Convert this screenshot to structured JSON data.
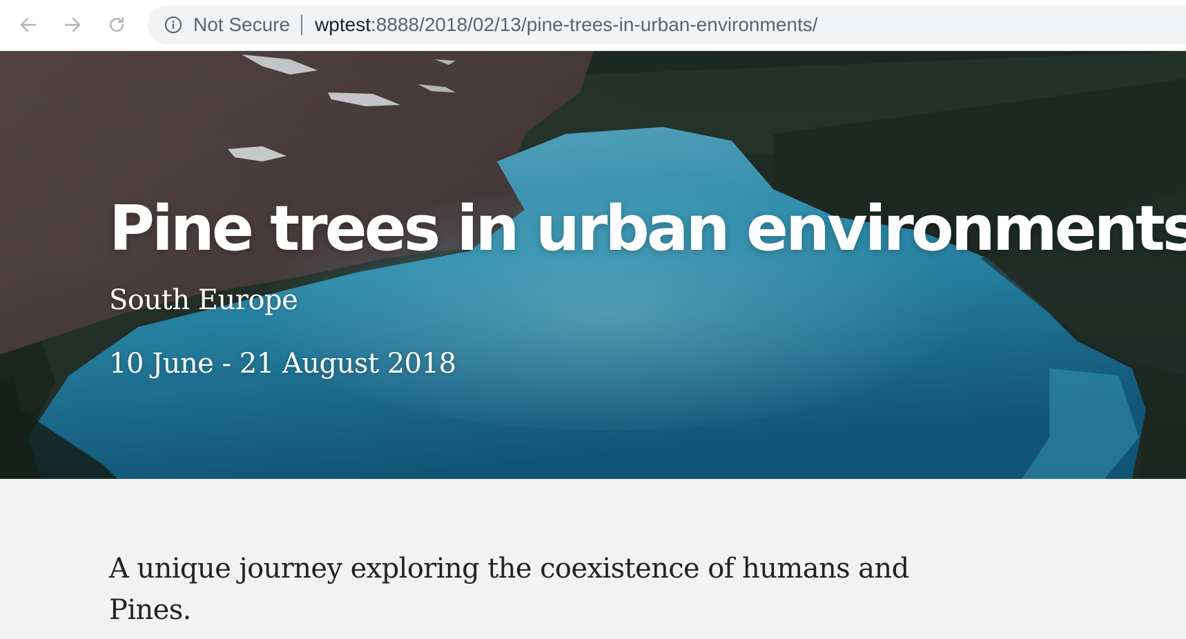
{
  "browser": {
    "security_label": "Not Secure",
    "url_host": "wptest",
    "url_path": ":8888/2018/02/13/pine-trees-in-urban-environments/",
    "icons": [
      "back-arrow-icon",
      "forward-arrow-icon",
      "reload-icon",
      "info-icon"
    ]
  },
  "hero": {
    "title": "Pine trees in urban environments",
    "location": "South Europe",
    "dates": "10 June - 21 August 2018"
  },
  "content": {
    "intro": "A unique journey exploring the coexistence of humans and Pines."
  },
  "colors": {
    "lake": "#2a8fae",
    "forest": "#1e2a24",
    "text_light": "#ffffff",
    "text_dark": "#222222",
    "page_bg": "#f2f2f2"
  }
}
